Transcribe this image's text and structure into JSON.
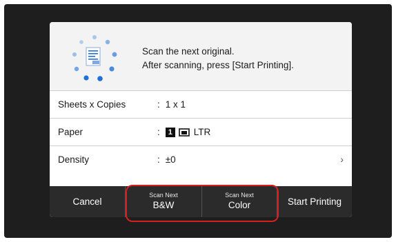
{
  "message": {
    "line1": "Scan the next original.",
    "line2": "After scanning, press [Start Printing]."
  },
  "settings": [
    {
      "label": "Sheets x Copies",
      "value": "1 x 1",
      "has_chevron": false
    },
    {
      "label": "Paper",
      "paper_number": "1",
      "value": "LTR",
      "has_chevron": false
    },
    {
      "label": "Density",
      "value": "±0",
      "has_chevron": true
    }
  ],
  "colon": ":",
  "chevron": "›",
  "toolbar": {
    "cancel": "Cancel",
    "scan_bw_top": "Scan Next",
    "scan_bw_bottom": "B&W",
    "scan_color_top": "Scan Next",
    "scan_color_bottom": "Color",
    "start_printing": "Start Printing"
  },
  "colors": {
    "frame": "#1e1e1e",
    "toolbar": "#2b2b2b",
    "highlight": "#d81e1e",
    "accent_blue": "#1e6fd9"
  }
}
